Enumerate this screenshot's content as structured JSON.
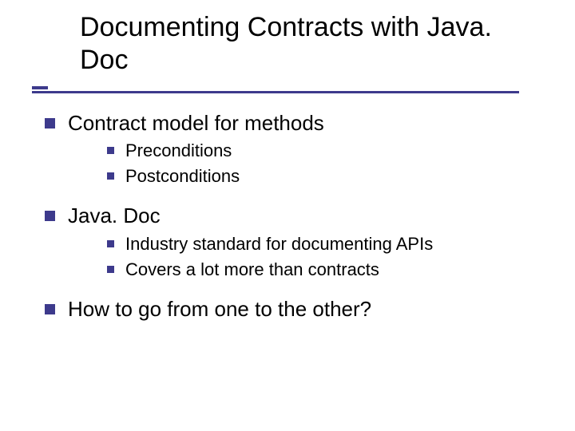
{
  "title": "Documenting Contracts with Java. Doc",
  "sections": [
    {
      "heading": "Contract model for methods",
      "items": [
        "Preconditions",
        "Postconditions"
      ]
    },
    {
      "heading": "Java. Doc",
      "items": [
        "Industry standard for documenting APIs",
        "Covers a lot more than contracts"
      ]
    },
    {
      "heading": "How to go from one to the other?",
      "items": []
    }
  ]
}
